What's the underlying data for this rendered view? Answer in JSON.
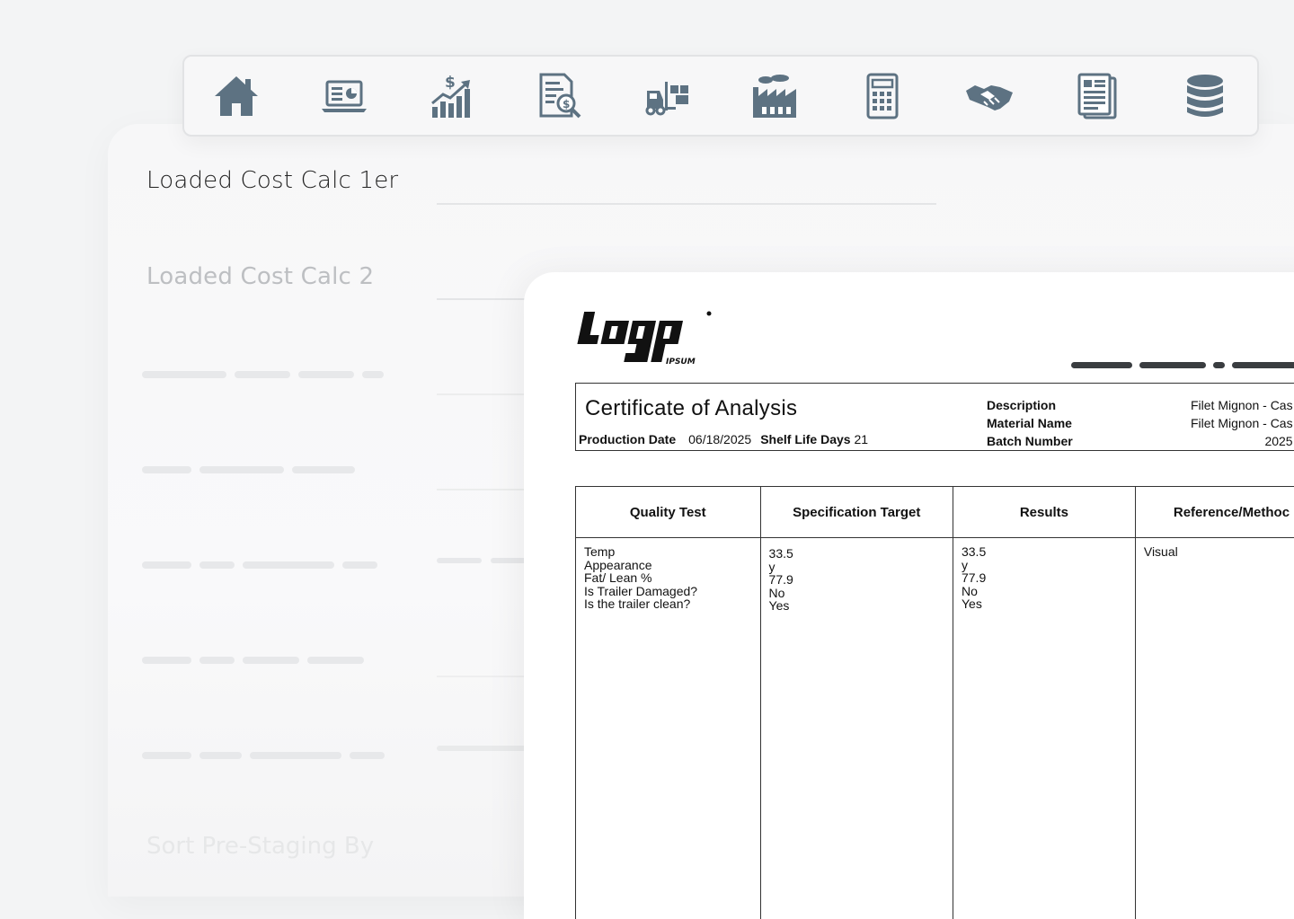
{
  "toolbar": {
    "icons": [
      "home-icon",
      "laptop-dashboard-icon",
      "sales-growth-icon",
      "invoice-search-icon",
      "forklift-warehouse-icon",
      "factory-icon",
      "calculator-icon",
      "handshake-icon",
      "report-document-icon",
      "database-icon"
    ]
  },
  "sidebar": {
    "item_1": "Loaded Cost Calc 1er",
    "item_2": "Loaded Cost Calc 2",
    "item_3": "Sort Pre-Staging By"
  },
  "document": {
    "logo_text": "LOGO",
    "logo_sub": "IPSUM",
    "title": "Certificate of Analysis",
    "production_date_label": "Production Date",
    "production_date": "06/18/2025",
    "shelf_life_label": "Shelf Life Days",
    "shelf_life": "21",
    "meta_labels": [
      "Description",
      "Material Name",
      "Batch Number"
    ],
    "meta_values": [
      "Filet Mignon - Cas",
      "Filet Mignon - Cas",
      "2025"
    ],
    "table": {
      "headers": [
        "Quality Test",
        "Specification Target",
        "Results",
        "Reference/Methoc"
      ],
      "quality_tests": [
        "Temp",
        "Appearance",
        "Fat/ Lean %",
        "Is Trailer Damaged?",
        "Is the trailer clean?"
      ],
      "spec_targets": [
        "33.5",
        "y",
        "77.9",
        "No",
        "Yes"
      ],
      "results": [
        "33.5",
        "y",
        "77.9",
        "No",
        "Yes"
      ],
      "reference": [
        "Visual"
      ]
    }
  },
  "colors": {
    "icon": "#5d7282",
    "background": "#f3f4f5",
    "document": "#ffffff"
  }
}
